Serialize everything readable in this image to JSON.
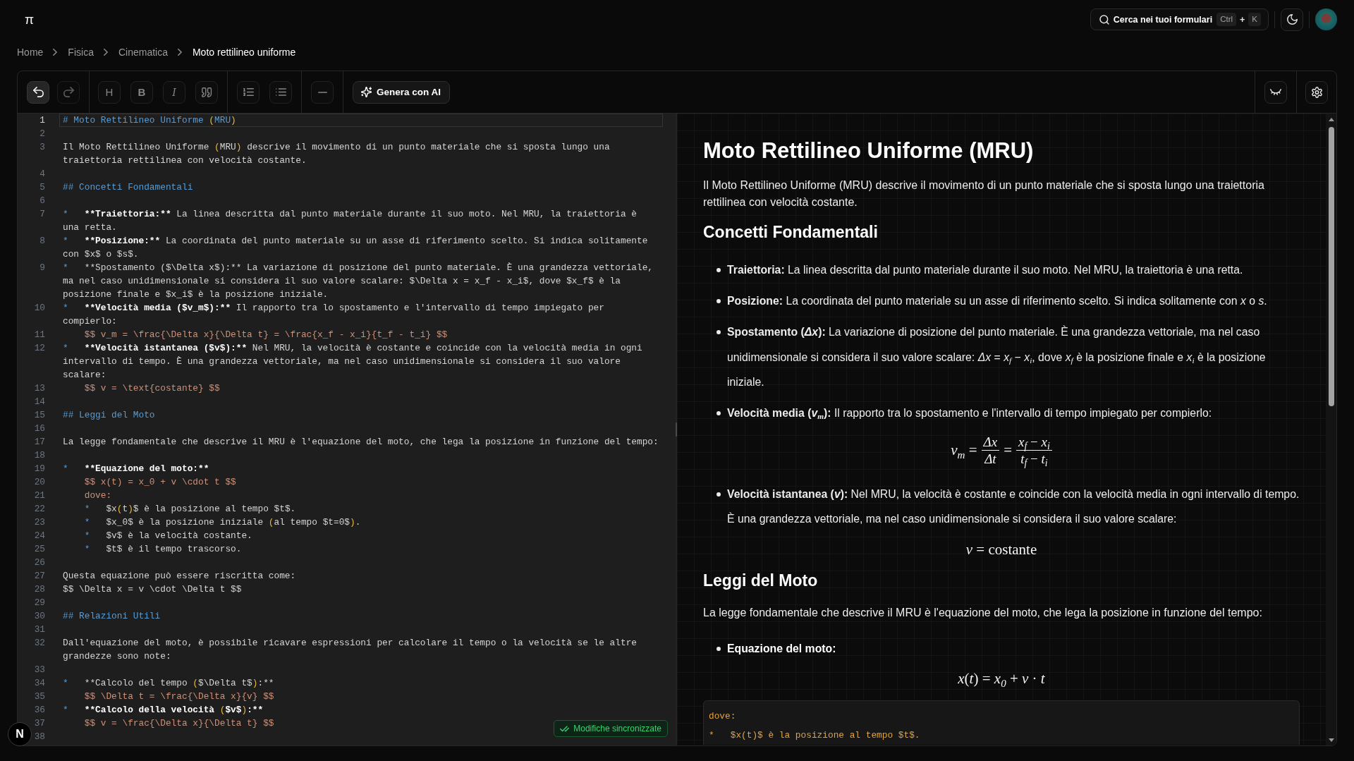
{
  "header": {
    "logo": "π",
    "search": {
      "label": "Cerca nei tuoi formulari",
      "shortcut": [
        {
          "kind": "key",
          "text": "Ctrl"
        },
        {
          "kind": "plus",
          "text": "+"
        },
        {
          "kind": "key",
          "text": "K"
        }
      ]
    }
  },
  "breadcrumb": [
    {
      "text": "Home",
      "current": false
    },
    {
      "text": "Fisica",
      "current": false
    },
    {
      "text": "Cinematica",
      "current": false
    },
    {
      "text": "Moto rettilineo uniforme",
      "current": true
    }
  ],
  "toolbar": {
    "groups": [
      {
        "buttons": [
          {
            "kind": "undo",
            "disabled": false
          },
          {
            "kind": "redo",
            "disabled": true
          }
        ]
      },
      {
        "buttons": [
          {
            "kind": "heading",
            "label": "H"
          },
          {
            "kind": "bold",
            "label": "B"
          },
          {
            "kind": "italic",
            "label": "I"
          },
          {
            "kind": "quote"
          }
        ]
      },
      {
        "buttons": [
          {
            "kind": "ordered-list"
          },
          {
            "kind": "bullet-list"
          }
        ]
      },
      {
        "buttons": [
          {
            "kind": "rule"
          }
        ]
      }
    ],
    "ai_button": {
      "label": "Genera con AI"
    },
    "right": [
      {
        "kind": "hide-preview"
      },
      {
        "kind": "settings"
      }
    ]
  },
  "editor": {
    "lines": [
      {
        "number": "1",
        "current": true,
        "rows": [
          [
            {
              "kind": "heading",
              "text": "# Moto Rettilineo Uniforme "
            },
            {
              "kind": "bracket",
              "text": "("
            },
            {
              "kind": "heading",
              "text": "MRU"
            },
            {
              "kind": "bracket",
              "text": ")"
            }
          ]
        ]
      },
      {
        "number": "2",
        "current": false
      },
      {
        "number": "3",
        "current": false,
        "rows": [
          [
            {
              "kind": "plain",
              "text": "Il Moto Rettilineo Uniforme "
            },
            {
              "kind": "bracket",
              "text": "("
            },
            {
              "kind": "plain",
              "text": "MRU"
            },
            {
              "kind": "bracket",
              "text": ")"
            },
            {
              "kind": "plain",
              "text": " descrive il movimento di un punto materiale che si sposta lungo una"
            }
          ],
          [
            {
              "kind": "plain",
              "text": "traiettoria rettilinea con velocità costante."
            }
          ]
        ]
      },
      {
        "number": "4",
        "current": false
      },
      {
        "number": "5",
        "current": false,
        "rows": [
          [
            {
              "kind": "heading",
              "text": "## Concetti Fondamentali"
            }
          ]
        ]
      },
      {
        "number": "6",
        "current": false
      },
      {
        "number": "7",
        "current": false,
        "rows": [
          [
            {
              "kind": "bullet",
              "text": "*   "
            },
            {
              "kind": "bold",
              "text": "**Traiettoria:**"
            },
            {
              "kind": "plain",
              "text": " La linea descritta dal punto materiale durante il suo moto. Nel MRU, la traiettoria è"
            }
          ],
          [
            {
              "kind": "plain",
              "text": "una retta."
            }
          ]
        ]
      },
      {
        "number": "8",
        "current": false,
        "rows": [
          [
            {
              "kind": "bullet",
              "text": "*   "
            },
            {
              "kind": "bold",
              "text": "**Posizione:**"
            },
            {
              "kind": "plain",
              "text": " La coordinata del punto materiale su un asse di riferimento scelto. Si indica solitamente"
            }
          ],
          [
            {
              "kind": "plain",
              "text": "con $x$ o $s$."
            }
          ]
        ]
      },
      {
        "number": "9",
        "current": false,
        "rows": [
          [
            {
              "kind": "bullet",
              "text": "*   "
            },
            {
              "kind": "plain",
              "text": "**Spostamento ($\\Delta x$):** La variazione di posizione del punto materiale. È una grandezza vettoriale,"
            }
          ],
          [
            {
              "kind": "plain",
              "text": "ma nel caso unidimensionale si considera il suo valore scalare: $\\Delta x = x_f - x_i$, dove $x_f$ è la"
            }
          ],
          [
            {
              "kind": "plain",
              "text": "posizione finale e $x_i$ è la posizione iniziale."
            }
          ]
        ]
      },
      {
        "number": "10",
        "current": false,
        "rows": [
          [
            {
              "kind": "bullet",
              "text": "*   "
            },
            {
              "kind": "bold",
              "text": "**Velocità media ($v_m$):**"
            },
            {
              "kind": "plain",
              "text": " Il rapporto tra lo spostamento e l'intervallo di tempo impiegato per"
            }
          ],
          [
            {
              "kind": "plain",
              "text": "compierlo:"
            }
          ]
        ]
      },
      {
        "number": "11",
        "current": false,
        "rows": [
          [
            {
              "kind": "math",
              "text": "    $$ v_m = \\frac{\\Delta x}{\\Delta t} = \\frac{x_f - x_i}{t_f - t_i} $$"
            }
          ]
        ]
      },
      {
        "number": "12",
        "current": false,
        "rows": [
          [
            {
              "kind": "bullet",
              "text": "*   "
            },
            {
              "kind": "bold",
              "text": "**Velocità istantanea ($v$):**"
            },
            {
              "kind": "plain",
              "text": " Nel MRU, la velocità è costante e coincide con la velocità media in ogni"
            }
          ],
          [
            {
              "kind": "plain",
              "text": "intervallo di tempo. È una grandezza vettoriale, ma nel caso unidimensionale si considera il suo valore"
            }
          ],
          [
            {
              "kind": "plain",
              "text": "scalare:"
            }
          ]
        ]
      },
      {
        "number": "13",
        "current": false,
        "rows": [
          [
            {
              "kind": "math",
              "text": "    $$ v = \\text{costante} $$"
            }
          ]
        ]
      },
      {
        "number": "14",
        "current": false
      },
      {
        "number": "15",
        "current": false,
        "rows": [
          [
            {
              "kind": "heading",
              "text": "## Leggi del Moto"
            }
          ]
        ]
      },
      {
        "number": "16",
        "current": false
      },
      {
        "number": "17",
        "current": false,
        "rows": [
          [
            {
              "kind": "plain",
              "text": "La legge fondamentale che descrive il MRU è l'equazione del moto, che lega la posizione in funzione del tempo:"
            }
          ]
        ]
      },
      {
        "number": "18",
        "current": false
      },
      {
        "number": "19",
        "current": false,
        "rows": [
          [
            {
              "kind": "bullet",
              "text": "*   "
            },
            {
              "kind": "bold",
              "text": "**Equazione del moto:**"
            }
          ]
        ]
      },
      {
        "number": "20",
        "current": false,
        "rows": [
          [
            {
              "kind": "math",
              "text": "    $$ x(t) = x_0 + v \\cdot t $$"
            }
          ]
        ]
      },
      {
        "number": "21",
        "current": false,
        "rows": [
          [
            {
              "kind": "math",
              "text": "    dove:"
            }
          ]
        ]
      },
      {
        "number": "22",
        "current": false,
        "rows": [
          [
            {
              "kind": "bullet",
              "text": "    *   "
            },
            {
              "kind": "plain",
              "text": "$x"
            },
            {
              "kind": "bracket",
              "text": "("
            },
            {
              "kind": "plain",
              "text": "t"
            },
            {
              "kind": "bracket",
              "text": ")"
            },
            {
              "kind": "plain",
              "text": "$ è la posizione al tempo $t$."
            }
          ]
        ]
      },
      {
        "number": "23",
        "current": false,
        "rows": [
          [
            {
              "kind": "bullet",
              "text": "    *   "
            },
            {
              "kind": "plain",
              "text": "$x_0$ è la posizione iniziale "
            },
            {
              "kind": "bracket",
              "text": "("
            },
            {
              "kind": "plain",
              "text": "al tempo $t=0$"
            },
            {
              "kind": "bracket",
              "text": ")"
            },
            {
              "kind": "plain",
              "text": "."
            }
          ]
        ]
      },
      {
        "number": "24",
        "current": false,
        "rows": [
          [
            {
              "kind": "bullet",
              "text": "    *   "
            },
            {
              "kind": "plain",
              "text": "$v$ è la velocità costante."
            }
          ]
        ]
      },
      {
        "number": "25",
        "current": false,
        "rows": [
          [
            {
              "kind": "bullet",
              "text": "    *   "
            },
            {
              "kind": "plain",
              "text": "$t$ è il tempo trascorso."
            }
          ]
        ]
      },
      {
        "number": "26",
        "current": false
      },
      {
        "number": "27",
        "current": false,
        "rows": [
          [
            {
              "kind": "plain",
              "text": "Questa equazione può essere riscritta come:"
            }
          ]
        ]
      },
      {
        "number": "28",
        "current": false,
        "rows": [
          [
            {
              "kind": "plain",
              "text": "$$ \\Delta x = v \\cdot \\Delta t $$"
            }
          ]
        ]
      },
      {
        "number": "29",
        "current": false
      },
      {
        "number": "30",
        "current": false,
        "rows": [
          [
            {
              "kind": "heading",
              "text": "## Relazioni Utili"
            }
          ]
        ]
      },
      {
        "number": "31",
        "current": false
      },
      {
        "number": "32",
        "current": false,
        "rows": [
          [
            {
              "kind": "plain",
              "text": "Dall'equazione del moto, è possibile ricavare espressioni per calcolare il tempo o la velocità se le altre"
            }
          ],
          [
            {
              "kind": "plain",
              "text": "grandezze sono note:"
            }
          ]
        ]
      },
      {
        "number": "33",
        "current": false
      },
      {
        "number": "34",
        "current": false,
        "rows": [
          [
            {
              "kind": "bullet",
              "text": "*   "
            },
            {
              "kind": "plain",
              "text": "**Calcolo del tempo "
            },
            {
              "kind": "bracket",
              "text": "("
            },
            {
              "kind": "plain",
              "text": "$\\Delta t$"
            },
            {
              "kind": "bracket",
              "text": ")"
            },
            {
              "kind": "plain",
              "text": ":**"
            }
          ]
        ]
      },
      {
        "number": "35",
        "current": false,
        "rows": [
          [
            {
              "kind": "math",
              "text": "    $$ \\Delta t = \\frac{\\Delta x}{v} $$"
            }
          ]
        ]
      },
      {
        "number": "36",
        "current": false,
        "rows": [
          [
            {
              "kind": "bullet",
              "text": "*   "
            },
            {
              "kind": "bold",
              "text": "**Calcolo della velocità "
            },
            {
              "kind": "bracket",
              "text": "("
            },
            {
              "kind": "bold",
              "text": "$v$"
            },
            {
              "kind": "bracket",
              "text": ")"
            },
            {
              "kind": "bold",
              "text": ":**"
            }
          ]
        ]
      },
      {
        "number": "37",
        "current": false,
        "rows": [
          [
            {
              "kind": "math",
              "text": "    $$ v = \\frac{\\Delta x}{\\Delta t} $$"
            }
          ]
        ]
      },
      {
        "number": "38",
        "current": false
      }
    ]
  },
  "preview": {
    "blocks": [
      {
        "kind": "title",
        "text": "Moto Rettilineo Uniforme (MRU)"
      },
      {
        "kind": "paragraph",
        "text": "Il Moto Rettilineo Uniforme (MRU) descrive il movimento di un punto materiale che si sposta lungo una traiettoria rettilinea con velocità costante."
      },
      {
        "kind": "heading",
        "text": "Concetti Fondamentali"
      },
      {
        "kind": "list",
        "items": [
          {
            "text": "**Traiettoria:** La linea descritta dal punto materiale durante il suo moto. Nel MRU, la traiettoria è una retta."
          },
          {
            "text": "**Posizione:** La coordinata del punto materiale su un asse di riferimento scelto. Si indica solitamente con *x* o *s*."
          },
          {
            "text": "**Spostamento (*Δx*):** La variazione di posizione del punto materiale. È una grandezza vettoriale, ma nel caso unidimensionale si considera il suo valore scalare: *Δx* = *x*$_{f}$ − *x*$_{i}$, dove *x*$_{f}$ è la posizione finale e *x*$_{i}$ è la posizione iniziale."
          },
          {
            "text": "**Velocità media (*v*$_{m}$):** Il rapporto tra lo spostamento e l'intervallo di tempo impiegato per compierlo:"
          }
        ]
      },
      {
        "kind": "equation",
        "parts": [
          {
            "kind": "text",
            "text": "*v*$_{m}$ ="
          },
          {
            "kind": "fraction",
            "numerator": "*Δx*",
            "denominator": "*Δt*"
          },
          {
            "kind": "text",
            "text": "="
          },
          {
            "kind": "fraction",
            "numerator": "*x*$_{f}$ − *x*$_{i}$",
            "denominator": "*t*$_{f}$ − *t*$_{i}$"
          }
        ]
      },
      {
        "kind": "list",
        "items": [
          {
            "text": "**Velocità istantanea (*v*):** Nel MRU, la velocità è costante e coincide con la velocità media in ogni intervallo di tempo. È una grandezza vettoriale, ma nel caso unidimensionale si considera il suo valore scalare:"
          }
        ]
      },
      {
        "kind": "equation",
        "parts": [
          {
            "kind": "text",
            "text": "*v* = costante"
          }
        ]
      },
      {
        "kind": "heading",
        "text": "Leggi del Moto"
      },
      {
        "kind": "paragraph",
        "text": "La legge fondamentale che descrive il MRU è l'equazione del moto, che lega la posizione in funzione del tempo:"
      },
      {
        "kind": "list",
        "items": [
          {
            "label": "Equazione del moto:"
          }
        ]
      },
      {
        "kind": "equation",
        "parts": [
          {
            "kind": "text",
            "text": "*x*(*t*) = *x*$_{0}$ + *v* · *t*"
          }
        ]
      },
      {
        "kind": "code",
        "lines": [
          "dove:",
          "*   $x(t)$ è la posizione al tempo $t$."
        ]
      }
    ]
  },
  "sync_status": {
    "text": "Modifiche sincronizzate"
  },
  "dev_indicator": {
    "label": "N"
  }
}
